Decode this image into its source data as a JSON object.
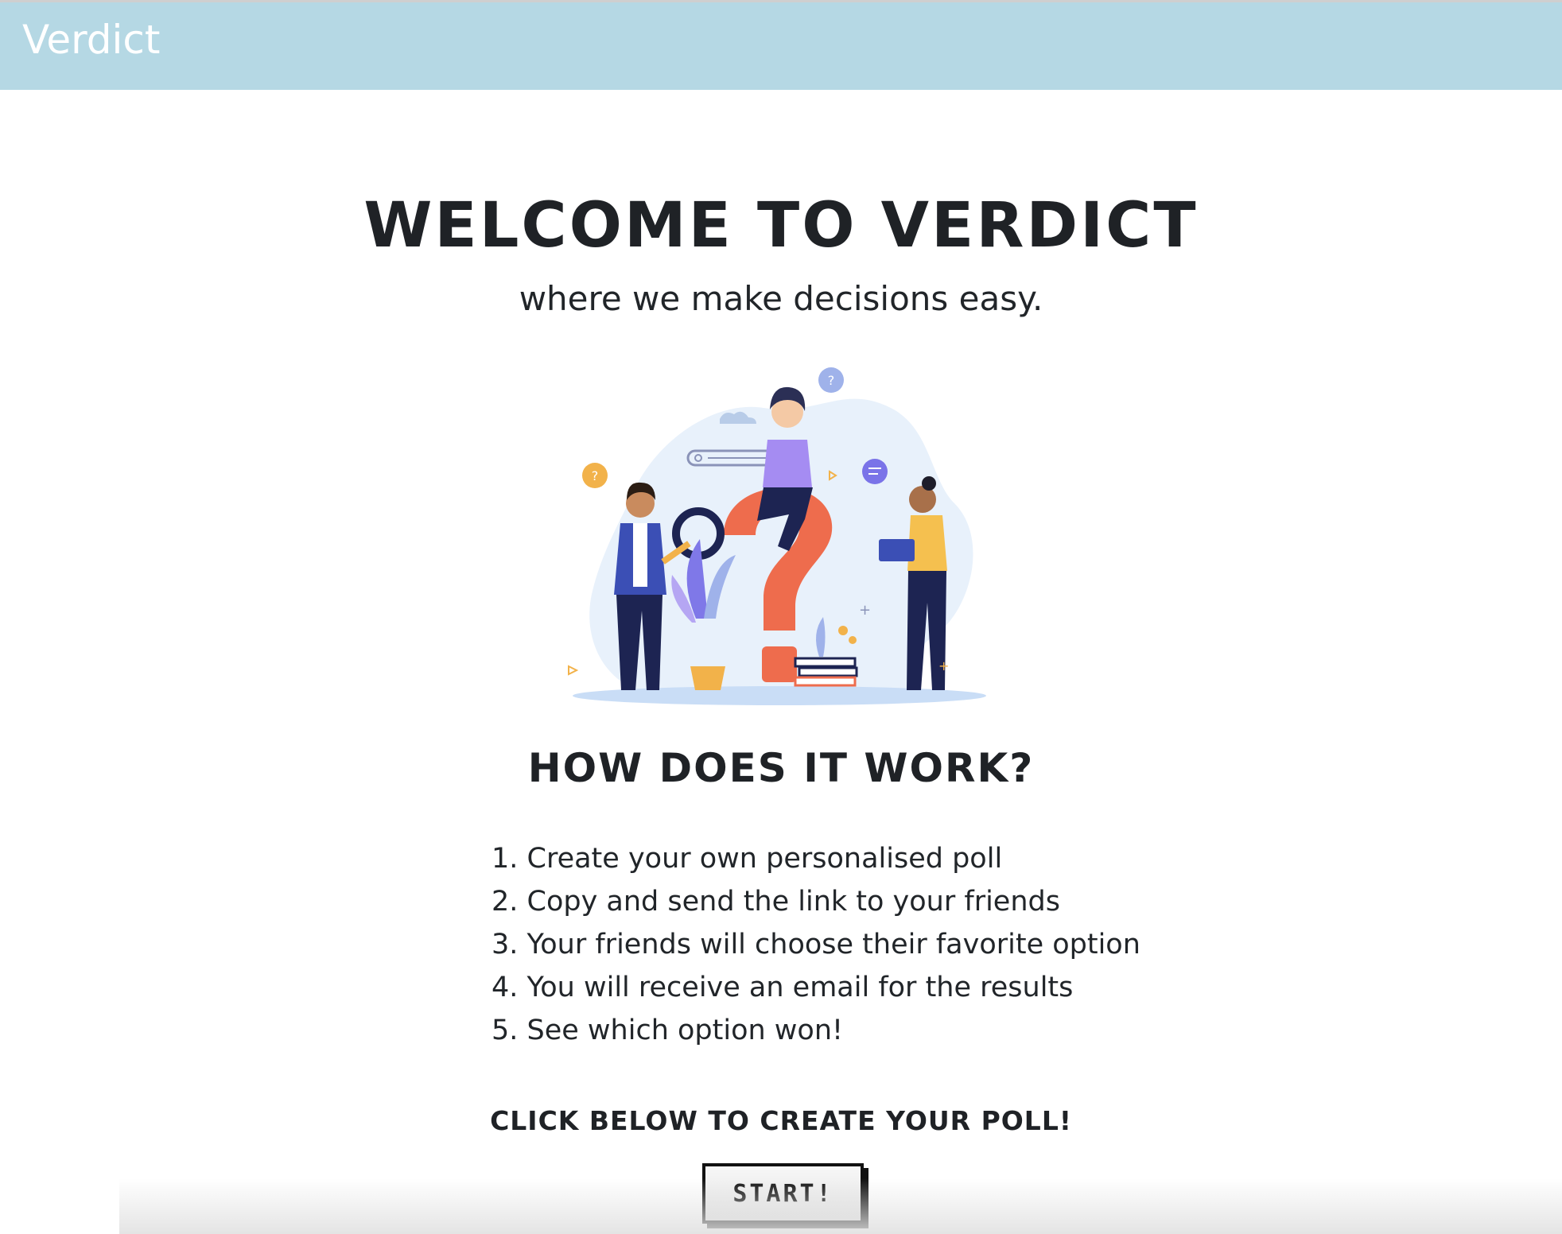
{
  "navbar": {
    "brand": "Verdict",
    "background": "#b5d8e4"
  },
  "hero": {
    "title": "Welcome to Verdict",
    "subtitle": "where we make decisions easy.",
    "illustration_icon": "people-with-question-mark-illustration"
  },
  "how": {
    "title": "How does it work?",
    "steps": [
      "1. Create your own personalised poll",
      "2. Copy and send the link to your friends",
      "3. Your friends will choose their favorite option",
      "4. You will receive an email for the results",
      "5. See which option won!"
    ]
  },
  "cta": {
    "text": "Click below to create your poll!",
    "button_label": "Start!"
  }
}
